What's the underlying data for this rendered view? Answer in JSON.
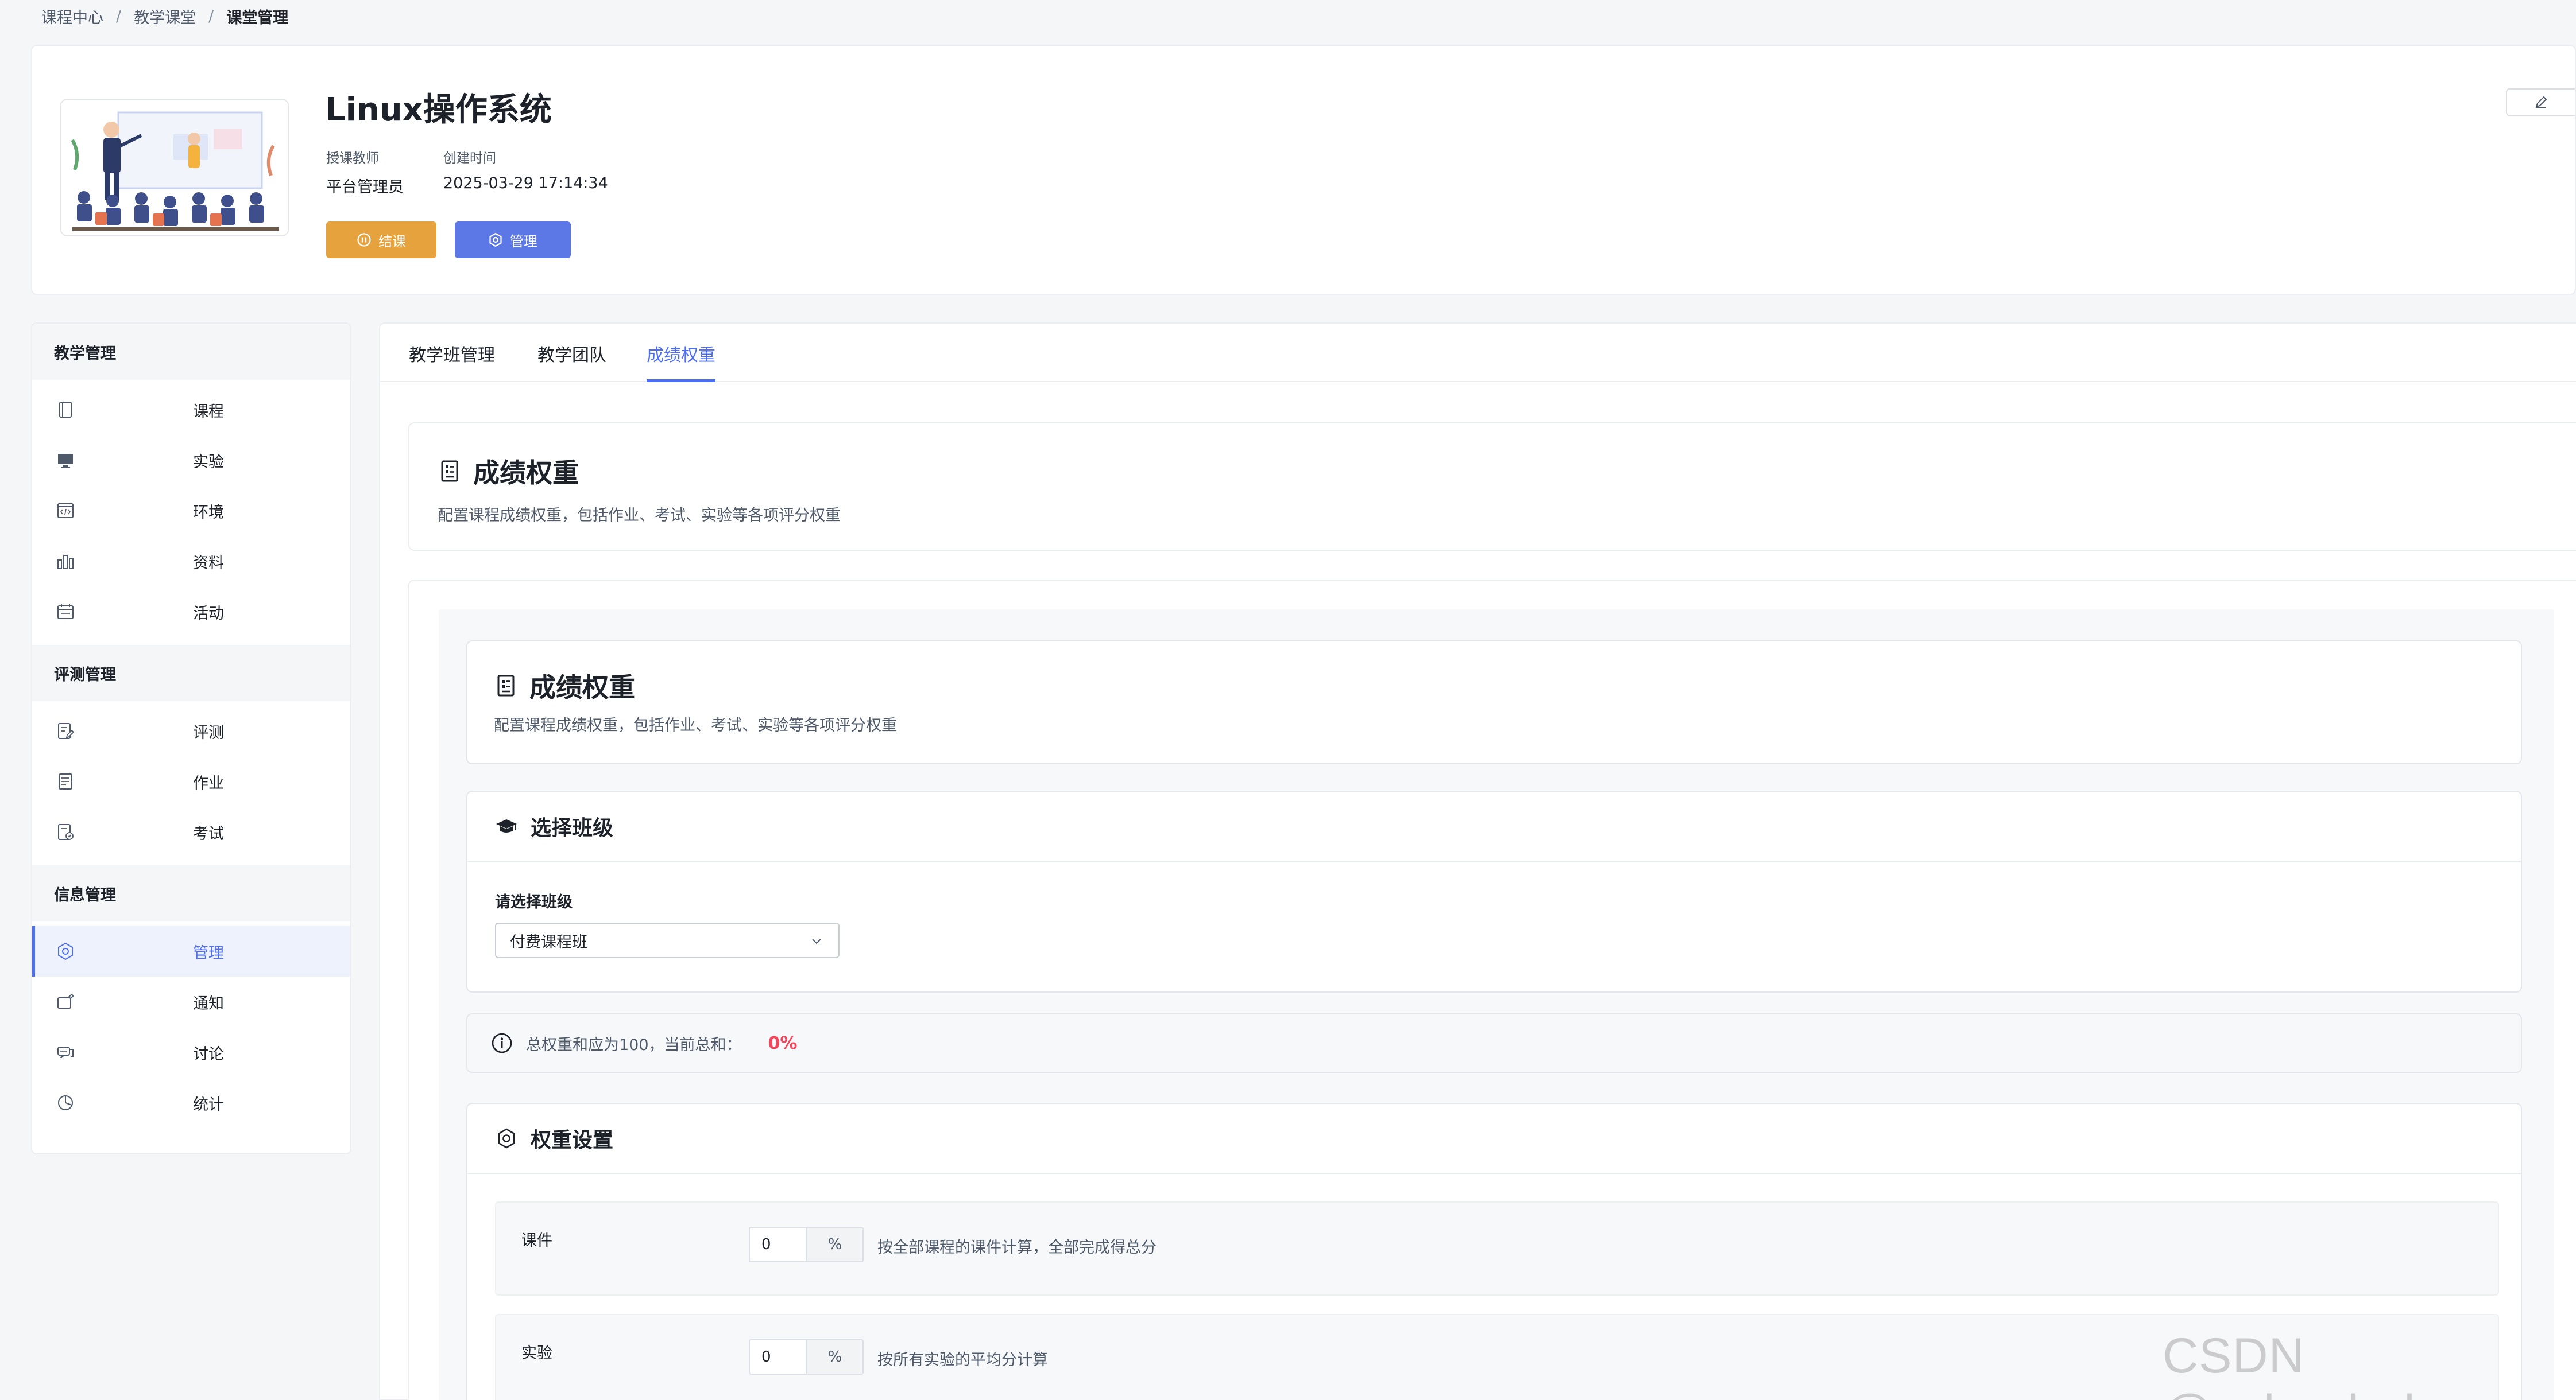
{
  "breadcrumb": [
    "课程中心",
    "教学课堂",
    "课堂管理"
  ],
  "breadcrumb_sep": "/",
  "course": {
    "title": "Linux操作系统",
    "teacher_label": "授课教师",
    "teacher": "平台管理员",
    "created_label": "创建时间",
    "created": "2025-03-29 17:14:34",
    "end_button": "结课",
    "manage_button": "管理"
  },
  "sidebar": {
    "groups": [
      {
        "title": "教学管理",
        "items": [
          {
            "label": "课程",
            "icon": "book-icon"
          },
          {
            "label": "实验",
            "icon": "monitor-icon"
          },
          {
            "label": "环境",
            "icon": "code-window-icon"
          },
          {
            "label": "资料",
            "icon": "bar-chart-icon"
          },
          {
            "label": "活动",
            "icon": "calendar-icon"
          }
        ]
      },
      {
        "title": "评测管理",
        "items": [
          {
            "label": "评测",
            "icon": "edit-document-icon"
          },
          {
            "label": "作业",
            "icon": "document-list-icon"
          },
          {
            "label": "考试",
            "icon": "exam-icon"
          }
        ]
      },
      {
        "title": "信息管理",
        "items": [
          {
            "label": "管理",
            "icon": "gear-icon",
            "active": true
          },
          {
            "label": "通知",
            "icon": "notice-icon"
          },
          {
            "label": "讨论",
            "icon": "chat-icon"
          },
          {
            "label": "统计",
            "icon": "pie-chart-icon"
          }
        ]
      }
    ]
  },
  "tabs": [
    {
      "label": "教学班管理"
    },
    {
      "label": "教学团队"
    },
    {
      "label": "成绩权重",
      "active": true
    }
  ],
  "intro": {
    "title": "成绩权重",
    "subtitle": "配置课程成绩权重，包括作业、考试、实验等各项评分权重"
  },
  "panel": {
    "title": "成绩权重",
    "subtitle": "配置课程成绩权重，包括作业、考试、实验等各项评分权重",
    "class_section": {
      "title": "选择班级",
      "field_label": "请选择班级",
      "selected": "付费课程班"
    },
    "tip": {
      "text": "总权重和应为100，当前总和：",
      "percent": "0%"
    },
    "weights": {
      "title": "权重设置",
      "unit": "%",
      "rows": [
        {
          "name": "课件",
          "value": "0",
          "desc": "按全部课程的课件计算，全部完成得总分"
        },
        {
          "name": "实验",
          "value": "0",
          "desc": "按所有实验的平均分计算"
        }
      ]
    }
  },
  "watermark": "CSDN @zcloudedu",
  "colors": {
    "primary": "#4e6ef2",
    "end_button": "#e6a23c",
    "manage_button": "#5b78e6",
    "percent_red": "#f5455b"
  }
}
